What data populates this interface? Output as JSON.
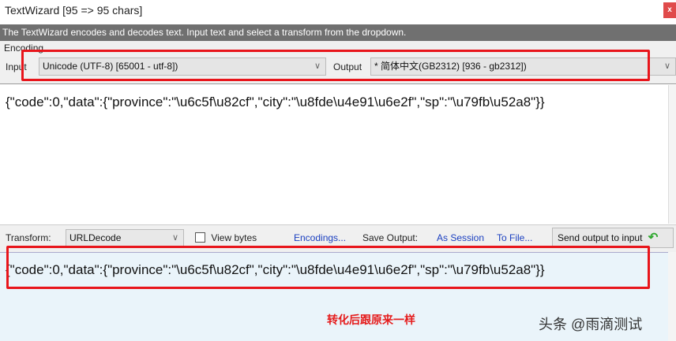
{
  "window": {
    "title": "TextWizard [95 => 95 chars]",
    "close": "x"
  },
  "info": "The TextWizard encodes and decodes text. Input text and select a transform from the dropdown.",
  "encoding": {
    "group_label": "Encoding",
    "input_label": "Input",
    "input_value": "Unicode (UTF-8) [65001 - utf-8])",
    "output_label": "Output",
    "output_value": "* 简体中文(GB2312) [936 - gb2312])"
  },
  "input_text": "{\"code\":0,\"data\":{\"province\":\"\\u6c5f\\u82cf\",\"city\":\"\\u8fde\\u4e91\\u6e2f\",\"sp\":\"\\u79fb\\u52a8\"}}",
  "toolbar": {
    "transform_label": "Transform:",
    "transform_value": "URLDecode",
    "view_bytes": "View bytes",
    "encodings": "Encodings...",
    "save_output": "Save Output:",
    "as_session": "As Session",
    "to_file": "To File...",
    "send": "Send output to input"
  },
  "output_text": "{\"code\":0,\"data\":{\"province\":\"\\u6c5f\\u82cf\",\"city\":\"\\u8fde\\u4e91\\u6e2f\",\"sp\":\"\\u79fb\\u52a8\"}}",
  "annotation": "转化后跟原来一样",
  "watermark": "头条 @雨滴测试"
}
